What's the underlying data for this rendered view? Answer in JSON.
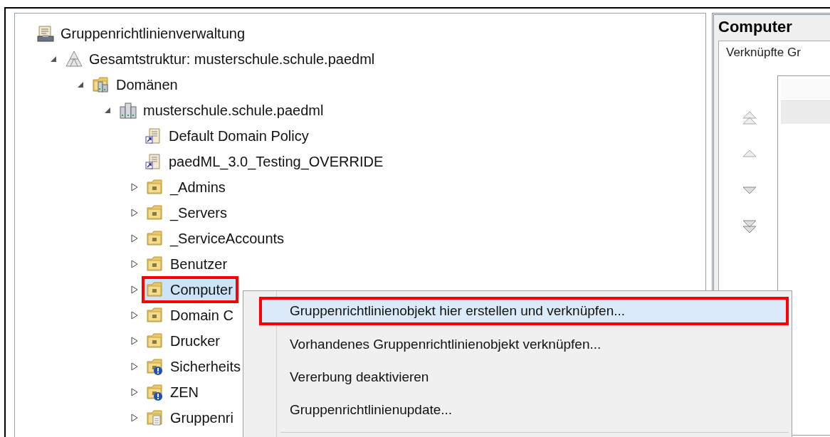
{
  "tree": [
    {
      "label": "Gruppenrichtlinienverwaltung",
      "kind": "console",
      "children": [
        {
          "label": "Gesamtstruktur: musterschule.schule.paedml",
          "kind": "forest",
          "expanded": true,
          "children": [
            {
              "label": "Domänen",
              "kind": "domains",
              "expanded": true,
              "children": [
                {
                  "label": "musterschule.schule.paedml",
                  "kind": "domain",
                  "expanded": true,
                  "children": [
                    {
                      "label": "Default Domain Policy",
                      "kind": "link"
                    },
                    {
                      "label": "paedML_3.0_Testing_OVERRIDE",
                      "kind": "link"
                    },
                    {
                      "label": "_Admins",
                      "kind": "unit",
                      "expanded": false
                    },
                    {
                      "label": "_Servers",
                      "kind": "unit",
                      "expanded": false
                    },
                    {
                      "label": "_ServiceAccounts",
                      "kind": "unit",
                      "expanded": false
                    },
                    {
                      "label": "Benutzer",
                      "kind": "unit",
                      "expanded": false
                    },
                    {
                      "label": "Computer",
                      "kind": "unit",
                      "expanded": false,
                      "selected": true,
                      "marked": true
                    },
                    {
                      "label": "Domain C",
                      "kind": "unit",
                      "expanded": false
                    },
                    {
                      "label": "Drucker",
                      "kind": "unit",
                      "expanded": false
                    },
                    {
                      "label": "Sicherheits",
                      "kind": "blocked",
                      "expanded": false
                    },
                    {
                      "label": "ZEN",
                      "kind": "blocked",
                      "expanded": false
                    },
                    {
                      "label": "Gruppenri",
                      "kind": "objects",
                      "expanded": false
                    }
                  ]
                }
              ]
            }
          ]
        }
      ]
    }
  ],
  "details": {
    "title": "Computer",
    "tab": "Verknüpfte Gr"
  },
  "context_menu": {
    "items": [
      {
        "label": "Gruppenrichtlinienobjekt hier erstellen und verknüpfen...",
        "selected": true,
        "marked": true
      },
      {
        "label": "Vorhandenes Gruppenrichtlinienobjekt verknüpfen...",
        "selected": false,
        "marked": false
      },
      {
        "label": "Vererbung deaktivieren",
        "selected": false,
        "marked": false
      },
      {
        "label": "Gruppenrichtlinienupdate...",
        "selected": false,
        "marked": false
      }
    ]
  }
}
